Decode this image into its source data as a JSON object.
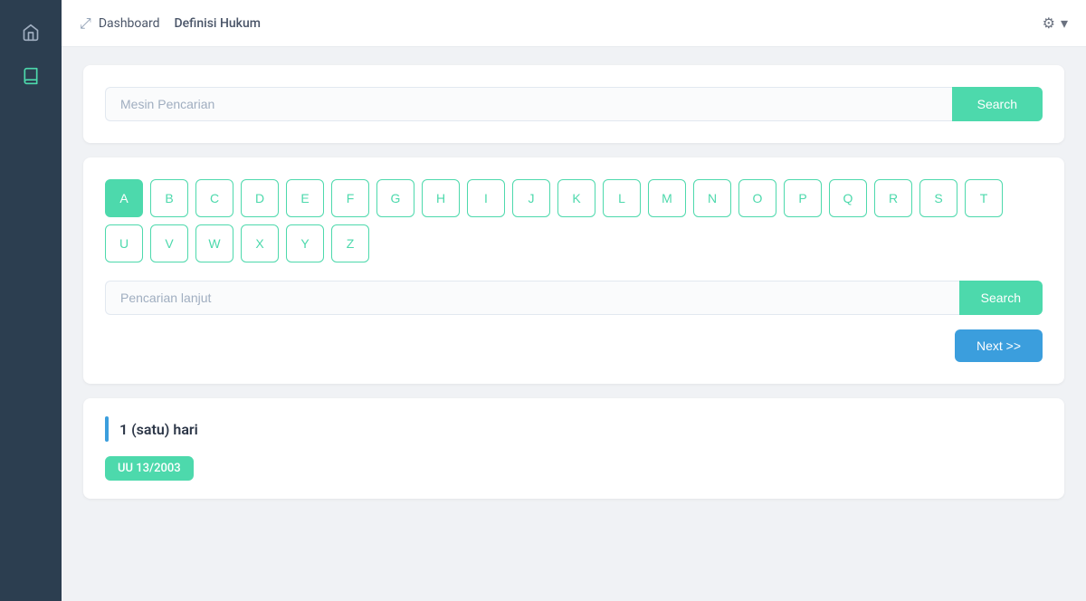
{
  "sidebar": {
    "icons": [
      {
        "name": "home-icon",
        "label": "Home",
        "active": false
      },
      {
        "name": "book-icon",
        "label": "Book",
        "active": true
      }
    ]
  },
  "header": {
    "expand_icon": "⤢",
    "breadcrumb": {
      "home": "Dashboard",
      "separator": "",
      "current": "Definisi Hukum"
    },
    "settings_icon": "⚙",
    "chevron_icon": "▾"
  },
  "search_card": {
    "input_placeholder": "Mesin Pencarian",
    "button_label": "Search"
  },
  "filter_card": {
    "alphabet": [
      "A",
      "B",
      "C",
      "D",
      "E",
      "F",
      "G",
      "H",
      "I",
      "J",
      "K",
      "L",
      "M",
      "N",
      "O",
      "P",
      "Q",
      "R",
      "S",
      "T",
      "U",
      "V",
      "W",
      "X",
      "Y",
      "Z"
    ],
    "active_letter": "A",
    "advanced_placeholder": "Pencarian lanjut",
    "advanced_btn_label": "Search",
    "next_btn_label": "Next >>"
  },
  "definition": {
    "title": "1 (satu) hari",
    "tag": "UU 13/2003"
  }
}
